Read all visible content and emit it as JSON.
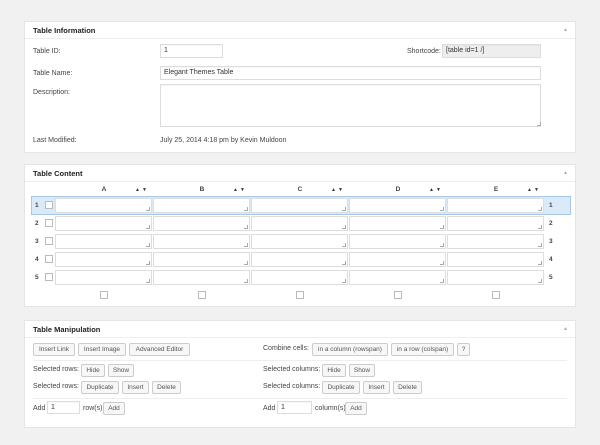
{
  "info": {
    "title": "Table Information",
    "id_label": "Table ID:",
    "id_value": "1",
    "shortcode_label": "Shortcode:",
    "shortcode_value": "[table id=1 /]",
    "name_label": "Table Name:",
    "name_value": "Elegant Themes Table",
    "desc_label": "Description:",
    "desc_value": "",
    "modified_label": "Last Modified:",
    "modified_value": "July 25, 2014 4:18 pm by Kevin Muldoon"
  },
  "content": {
    "title": "Table Content",
    "columns": [
      "A",
      "B",
      "C",
      "D",
      "E"
    ],
    "rows": [
      "1",
      "2",
      "3",
      "4",
      "5"
    ],
    "sort_arrows": "▲▼",
    "cells": [
      [
        "",
        "",
        "",
        "",
        ""
      ],
      [
        "",
        "",
        "",
        "",
        ""
      ],
      [
        "",
        "",
        "",
        "",
        ""
      ],
      [
        "",
        "",
        "",
        "",
        ""
      ],
      [
        "",
        "",
        "",
        "",
        ""
      ]
    ]
  },
  "manip": {
    "title": "Table Manipulation",
    "insert_link": "Insert Link",
    "insert_image": "Insert Image",
    "advanced_editor": "Advanced Editor",
    "combine_label": "Combine cells:",
    "rowspan": "in a column (rowspan)",
    "colspan": "in a row (colspan)",
    "help": "?",
    "sel_rows_label": "Selected rows:",
    "hide": "Hide",
    "show": "Show",
    "sel_cols_label": "Selected columns:",
    "duplicate": "Duplicate",
    "insert": "Insert",
    "delete": "Delete",
    "add_label": "Add",
    "add_rows_value": "1",
    "rows_suffix": "row(s)",
    "add_cols_value": "1",
    "cols_suffix": "column(s)",
    "add_btn": "Add"
  },
  "toggle_icon": "▲"
}
